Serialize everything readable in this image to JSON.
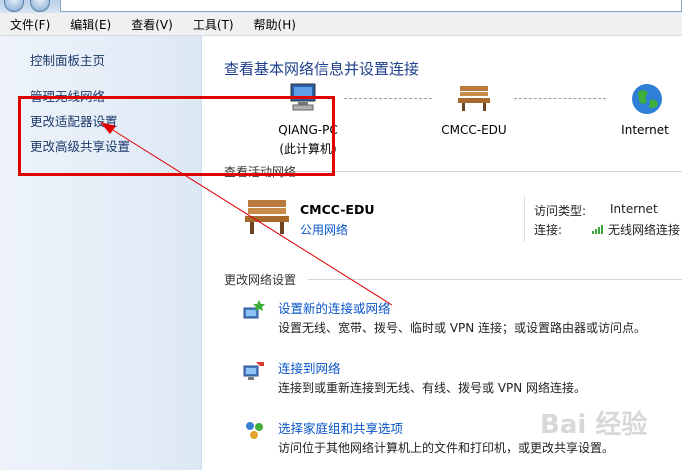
{
  "menu": [
    "文件(F)",
    "编辑(E)",
    "查看(V)",
    "工具(T)",
    "帮助(H)"
  ],
  "sidebar": {
    "items": [
      {
        "label": "控制面板主页"
      },
      {
        "label": "管理无线网络"
      },
      {
        "label": "更改适配器设置"
      },
      {
        "label": "更改高级共享设置"
      }
    ]
  },
  "main": {
    "title": "查看基本网络信息并设置连接",
    "map": {
      "computer_name": "QIANG-PC",
      "computer_sub": "(此计算机)",
      "network_name": "CMCC-EDU",
      "internet_label": "Internet"
    },
    "active": {
      "heading": "查看活动网络",
      "network_name": "CMCC-EDU",
      "network_type": "公用网络",
      "access_type_key": "访问类型:",
      "access_type_val": "Internet",
      "connection_key": "连接:",
      "connection_val": "无线网络连接"
    },
    "change": {
      "heading": "更改网络设置",
      "tasks": [
        {
          "link": "设置新的连接或网络",
          "desc": "设置无线、宽带、拨号、临时或 VPN 连接；或设置路由器或访问点。",
          "icon": "setup-connection-icon"
        },
        {
          "link": "连接到网络",
          "desc": "连接到或重新连接到无线、有线、拨号或 VPN 网络连接。",
          "icon": "connect-network-icon"
        },
        {
          "link": "选择家庭组和共享选项",
          "desc": "访问位于其他网络计算机上的文件和打印机，或更改共享设置。",
          "icon": "homegroup-icon"
        }
      ]
    }
  },
  "watermark": "Bai 经验",
  "colors": {
    "link": "#0a56c8",
    "annotation": "#e00000",
    "title": "#1e3f8a"
  }
}
